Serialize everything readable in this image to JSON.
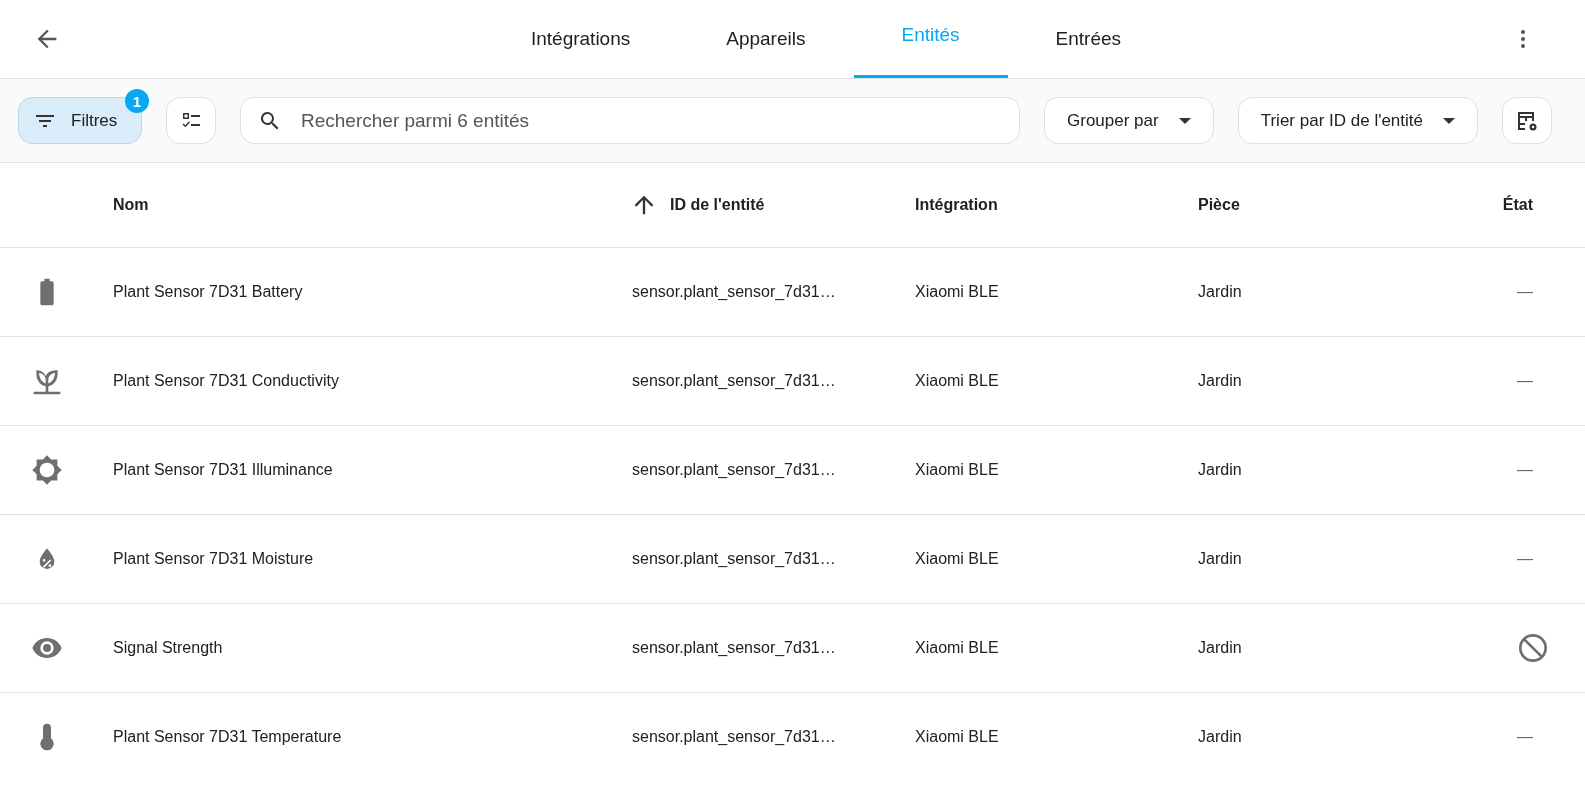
{
  "tabs": [
    {
      "label": "Intégrations",
      "selected": false
    },
    {
      "label": "Appareils",
      "selected": false
    },
    {
      "label": "Entités",
      "selected": true
    },
    {
      "label": "Entrées",
      "selected": false
    }
  ],
  "toolbar": {
    "filters": {
      "label": "Filtres",
      "badge": "1"
    },
    "search": {
      "placeholder": "Rechercher parmi 6 entités"
    },
    "group_by": "Grouper par",
    "sort_by": "Trier par ID de l'entité"
  },
  "table": {
    "columns": [
      "Nom",
      "ID de l'entité",
      "Intégration",
      "Pièce",
      "État"
    ],
    "rows": [
      {
        "kind": "battery",
        "name": "Plant Sensor 7D31 Battery",
        "entity_id": "sensor.plant_sensor_7d31…",
        "integration": "Xiaomi BLE",
        "area": "Jardin",
        "disabled": false,
        "state": "—"
      },
      {
        "kind": "plant",
        "name": "Plant Sensor 7D31 Conductivity",
        "entity_id": "sensor.plant_sensor_7d31…",
        "integration": "Xiaomi BLE",
        "area": "Jardin",
        "disabled": false,
        "state": "—"
      },
      {
        "kind": "sun",
        "name": "Plant Sensor 7D31 Illuminance",
        "entity_id": "sensor.plant_sensor_7d31…",
        "integration": "Xiaomi BLE",
        "area": "Jardin",
        "disabled": false,
        "state": "—"
      },
      {
        "kind": "drop",
        "name": "Plant Sensor 7D31 Moisture",
        "entity_id": "sensor.plant_sensor_7d31…",
        "integration": "Xiaomi BLE",
        "area": "Jardin",
        "disabled": false,
        "state": "—"
      },
      {
        "kind": "eye",
        "name": "Signal Strength",
        "entity_id": "sensor.plant_sensor_7d31…",
        "integration": "Xiaomi BLE",
        "area": "Jardin",
        "disabled": true
      },
      {
        "kind": "thermometer",
        "name": "Plant Sensor 7D31 Temperature",
        "entity_id": "sensor.plant_sensor_7d31…",
        "integration": "Xiaomi BLE",
        "area": "Jardin",
        "disabled": false,
        "state": "—"
      }
    ]
  }
}
